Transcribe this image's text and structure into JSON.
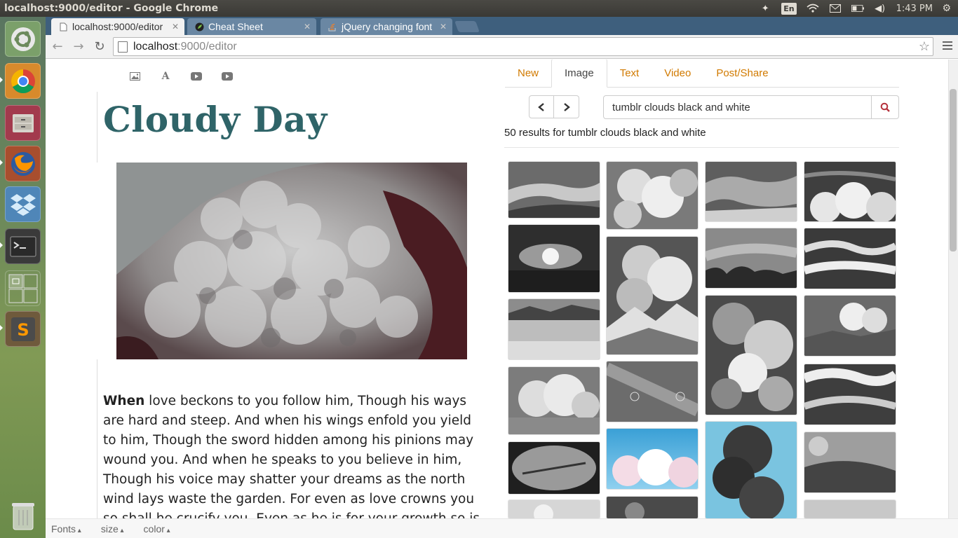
{
  "window": {
    "title": "localhost:9000/editor - Google Chrome"
  },
  "tray": {
    "lang": "En",
    "time": "1:43 PM"
  },
  "tabs": [
    {
      "label": "localhost:9000/editor"
    },
    {
      "label": "Cheat Sheet"
    },
    {
      "label": "jQuery changing font"
    }
  ],
  "address": {
    "host": "localhost",
    "rest": ":9000/editor"
  },
  "editor": {
    "title": "Cloudy Day",
    "body_lead": "When",
    "body_rest": " love beckons to you follow him, Though his ways are hard and steep. And when his wings enfold you yield to him, Though the sword hidden among his pinions may wound you. And when he speaks to you believe in him, Though his voice may shatter your dreams as the north wind lays waste the garden. For even as love crowns you so shall he crucify you. Even as he is for your growth so is he"
  },
  "panel": {
    "tabs": [
      "New",
      "Image",
      "Text",
      "Video",
      "Post/Share"
    ],
    "active_tab": "Image",
    "search_value": "tumblr clouds black and white",
    "results_text": "50 results for tumblr clouds black and white"
  },
  "bottom": {
    "fonts": "Fonts",
    "size": "size",
    "color": "color"
  },
  "colors": {
    "title": "#2f6468",
    "tab_link": "#d17a00",
    "search_icon": "#b5323c"
  }
}
